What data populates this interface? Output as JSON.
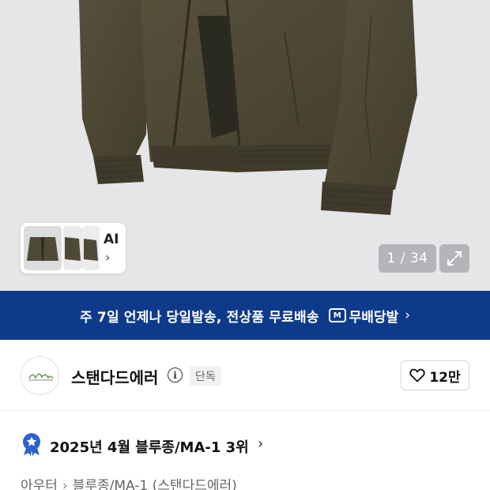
{
  "gallery": {
    "ai_label": "AI",
    "counter": "1 / 34",
    "expand_icon": "expand-icon",
    "jacket_color": "#4f4a36"
  },
  "banner": {
    "text": "주 7일 언제나 당일발송, 전상품 무료배송",
    "logo_mark": "M",
    "logo_text": "무배당발",
    "background": "#0e3a8c"
  },
  "brand": {
    "name": "스탠다드에러",
    "info_glyph": "i",
    "badge": "단독",
    "likes": "12만"
  },
  "ranking": {
    "text": "2025년 4월 블루종/MA-1 3위",
    "badge_color": "#2f5fd0"
  },
  "breadcrumb": {
    "level1": "아우터",
    "level2": "블루종/MA-1 (스탠다드에러)"
  }
}
